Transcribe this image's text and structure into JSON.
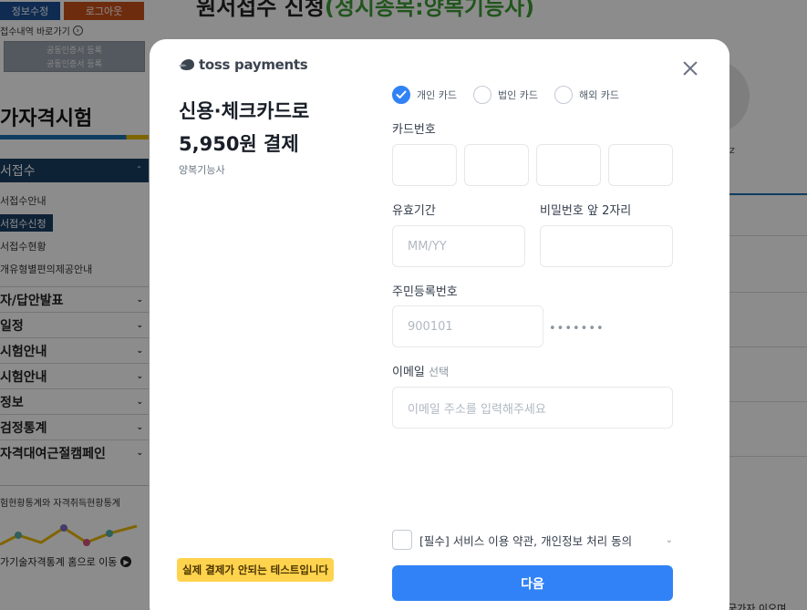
{
  "background": {
    "header_buttons": {
      "edit_profile": "정보수정",
      "logout": "로그아웃"
    },
    "back_link": "접수내역 바로가기",
    "cert_buttons": [
      "공동인증서 등록",
      "공동인증서 등록"
    ],
    "page_title_prefix": "원서접수 신청",
    "page_title_suffix": "(정시종목:양복기능사)",
    "side_heading": "가자격시험",
    "side_active": "서접수",
    "sub_items": [
      "서접수안내",
      "서접수신청",
      "서접수현황",
      "개유형별편의제공안내"
    ],
    "sub_selected_index": 1,
    "side_items": [
      "자/답안발표",
      "일정",
      "시험안내",
      "시험안내",
      "정보",
      "검정통계",
      "자격대여근절캠페인"
    ],
    "stats_title": "험현황통계와 자격취득현황통계",
    "stats_link": "가기술자격통계 홈으로 이동",
    "right_z": "z",
    "bottom_text": "국가자 이오며"
  },
  "modal": {
    "logo_text": "toss payments",
    "title": "신용·체크카드로",
    "amount": "5,950원 결제",
    "merchant": "양복기능사",
    "test_badge": "실제 결제가 안되는 테스트입니다",
    "card_types": [
      {
        "label": "개인 카드",
        "checked": true
      },
      {
        "label": "법인 카드",
        "checked": false
      },
      {
        "label": "해외 카드",
        "checked": false
      }
    ],
    "card_number_label": "카드번호",
    "expiry_label": "유효기간",
    "expiry_placeholder": "MM/YY",
    "password_label": "비밀번호 앞 2자리",
    "ssn_label": "주민등록번호",
    "ssn_placeholder": "900101",
    "ssn_masked": "•••••••",
    "email_label": "이메일",
    "email_optional": "선택",
    "email_placeholder": "이메일 주소를 입력해주세요",
    "agree_text": "[필수] 서비스 이용 약관, 개인정보 처리 동의",
    "next_button": "다음"
  },
  "colors": {
    "primary_blue": "#3182f6",
    "badge_yellow": "#ffd34e",
    "title_green": "#3d9b35",
    "nav_dark": "#1a3f63"
  }
}
